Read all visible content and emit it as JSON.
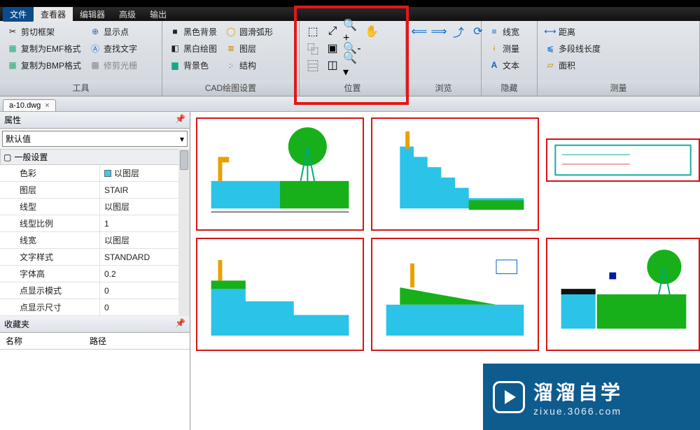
{
  "menu": {
    "file": "文件",
    "viewer": "查看器",
    "editor": "编辑器",
    "advanced": "高级",
    "output": "输出"
  },
  "ribbon": {
    "tools": {
      "label": "工具",
      "crop": "剪切框架",
      "copy_emf": "复制为EMF格式",
      "copy_bmp": "复制为BMP格式",
      "show_point": "显示点",
      "find_text": "查找文字",
      "trim_raster": "修剪光栅"
    },
    "cad": {
      "label": "CAD绘图设置",
      "black_bg": "黑色背景",
      "bw_draw": "黑白绘图",
      "bg_color": "背景色",
      "smooth_arc": "圆滑弧形",
      "layers": "图层",
      "structure": "结构"
    },
    "position": {
      "label": "位置"
    },
    "browse": {
      "label": "浏览"
    },
    "hide": {
      "label": "隐藏",
      "linewidth": "线宽",
      "measure": "测量",
      "text": "文本"
    },
    "measure": {
      "label": "测量",
      "distance": "距离",
      "polyline": "多段线长度",
      "area": "面积"
    }
  },
  "doc_tab": "a-10.dwg",
  "props": {
    "title": "属性",
    "default_combo": "默认值",
    "cat_general": "一般设置",
    "rows": [
      {
        "k": "色彩",
        "v": "以图层",
        "swatch": true
      },
      {
        "k": "图层",
        "v": "STAIR"
      },
      {
        "k": "线型",
        "v": "以图层"
      },
      {
        "k": "线型比例",
        "v": "1"
      },
      {
        "k": "线宽",
        "v": "以图层"
      },
      {
        "k": "文字样式",
        "v": "STANDARD"
      },
      {
        "k": "字体高",
        "v": "0.2"
      },
      {
        "k": "点显示模式",
        "v": "0"
      },
      {
        "k": "点显示尺寸",
        "v": "0"
      }
    ]
  },
  "fav": {
    "title": "收藏夹",
    "col_name": "名称",
    "col_path": "路径"
  },
  "watermark": {
    "main": "溜溜自学",
    "sub": "zixue.3066.com"
  }
}
